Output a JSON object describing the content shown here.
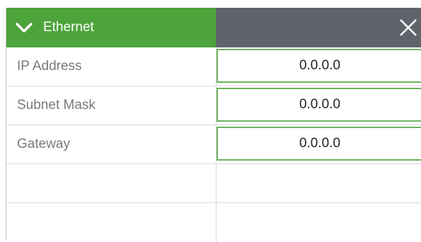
{
  "header": {
    "title": "Ethernet"
  },
  "rows": [
    {
      "label": "IP Address",
      "value": "0.0.0.0"
    },
    {
      "label": "Subnet Mask",
      "value": "0.0.0.0"
    },
    {
      "label": "Gateway",
      "value": "0.0.0.0"
    }
  ],
  "colors": {
    "header_green": "#4ca43b",
    "header_gray": "#5f646c",
    "field_border": "#6cb35d"
  },
  "icons": {
    "collapse": "chevron-down-icon",
    "close": "close-icon"
  }
}
